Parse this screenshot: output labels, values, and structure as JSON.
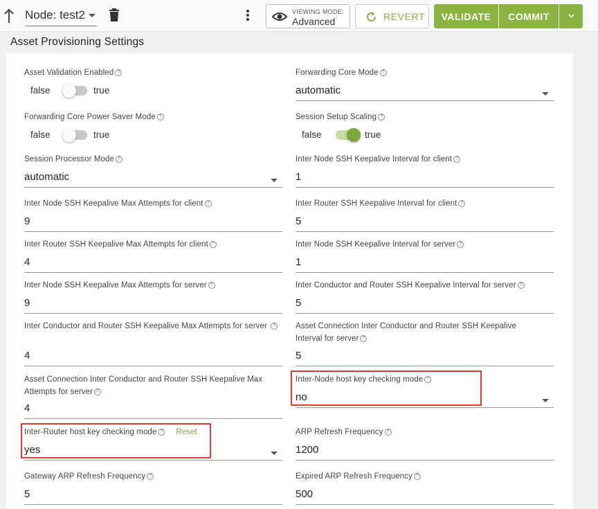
{
  "toolbar": {
    "node_label": "Node: test2",
    "viewing_mode_caption": "VIEWING MODE:",
    "viewing_mode_value": "Advanced",
    "revert_label": "REVERT",
    "validate_label": "VALIDATE",
    "commit_label": "COMMIT"
  },
  "section_title": "Asset Provisioning Settings",
  "reset_label": "Reset",
  "colors": {
    "accent": "#8ab33f",
    "highlight": "#e03c31"
  },
  "fields": {
    "asset_validation_enabled": {
      "label": "Asset Validation Enabled",
      "false_label": "false",
      "true_label": "true",
      "value": false
    },
    "forwarding_core_mode": {
      "label": "Forwarding Core Mode",
      "value": "automatic"
    },
    "forwarding_core_power_saver_mode": {
      "label": "Forwarding Core Power Saver Mode",
      "false_label": "false",
      "true_label": "true",
      "value": false
    },
    "session_setup_scaling": {
      "label": "Session Setup Scaling",
      "false_label": "false",
      "true_label": "true",
      "value": true
    },
    "session_processor_mode": {
      "label": "Session Processor Mode",
      "value": "automatic"
    },
    "inter_node_ssh_keepalive_interval_client": {
      "label": "Inter Node SSH Keepalive Interval for client",
      "value": "1"
    },
    "inter_node_ssh_keepalive_max_attempts_client": {
      "label": "Inter Node SSH Keepalive Max Attempts for client",
      "value": "9"
    },
    "inter_router_ssh_keepalive_interval_client": {
      "label": "Inter Router SSH Keepalive Interval for client",
      "value": "5"
    },
    "inter_router_ssh_keepalive_max_attempts_client": {
      "label": "Inter Router SSH Keepalive Max Attempts for client",
      "value": "4"
    },
    "inter_node_ssh_keepalive_interval_server": {
      "label": "Inter Node SSH Keepalive Interval for server",
      "value": "1"
    },
    "inter_node_ssh_keepalive_max_attempts_server": {
      "label": "Inter Node SSH Keepalive Max Attempts for server",
      "value": "9"
    },
    "inter_conductor_router_ssh_keepalive_interval_server": {
      "label": "Inter Conductor and Router SSH Keepalive Interval for server",
      "value": "5"
    },
    "inter_conductor_router_ssh_keepalive_max_attempts_server": {
      "label": "Inter Conductor and Router SSH Keepalive Max Attempts for server",
      "value": "4"
    },
    "asset_connection_inter_conductor_router_ssh_keepalive_interval_server": {
      "label": "Asset Connection Inter Conductor and Router SSH Keepalive Interval for server",
      "value": "5"
    },
    "asset_connection_inter_conductor_router_ssh_keepalive_max_attempts_server": {
      "label": "Asset Connection Inter Conductor and Router SSH Keepalive Max Attempts for server",
      "value": "4"
    },
    "inter_node_host_key_checking_mode": {
      "label": "Inter-Node host key checking mode",
      "value": "no"
    },
    "inter_router_host_key_checking_mode": {
      "label": "Inter-Router host key checking mode",
      "value": "yes"
    },
    "arp_refresh_frequency": {
      "label": "ARP Refresh Frequency",
      "value": "1200"
    },
    "gateway_arp_refresh_frequency": {
      "label": "Gateway ARP Refresh Frequency",
      "value": "5"
    },
    "expired_arp_refresh_frequency": {
      "label": "Expired ARP Refresh Frequency",
      "value": "500"
    }
  }
}
